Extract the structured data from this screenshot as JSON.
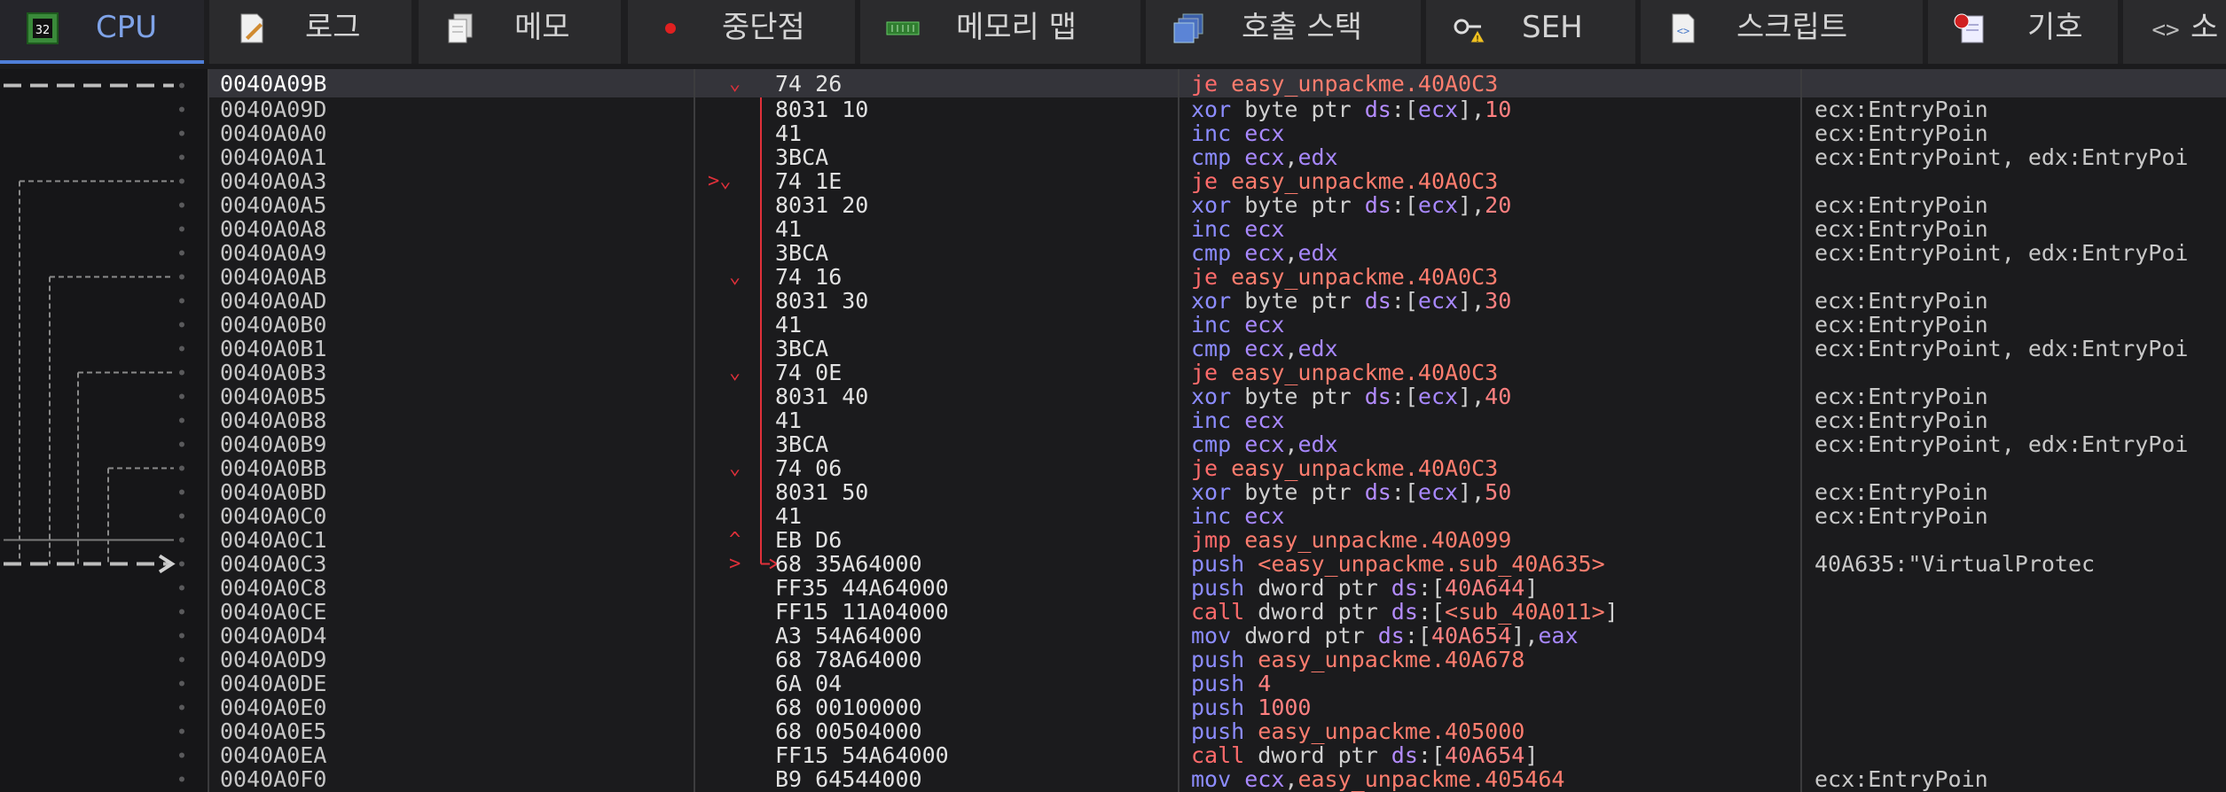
{
  "tabs": [
    {
      "label": "CPU",
      "icon": "cpu-chip-icon",
      "active": true
    },
    {
      "label": "로그",
      "icon": "log-icon"
    },
    {
      "label": "메모",
      "icon": "notes-icon"
    },
    {
      "label": "중단점",
      "icon": "breakpoint-icon"
    },
    {
      "label": "메모리 맵",
      "icon": "memory-map-icon"
    },
    {
      "label": "호출 스택",
      "icon": "call-stack-icon"
    },
    {
      "label": "SEH",
      "icon": "seh-icon"
    },
    {
      "label": "스크립트",
      "icon": "script-icon"
    },
    {
      "label": "기호",
      "icon": "symbols-icon"
    },
    {
      "label": "소",
      "icon": "source-icon"
    }
  ],
  "colors": {
    "accent": "#4f7fd8",
    "jump": "#ff6b6b",
    "register": "#a888ff",
    "arrow": "#e0303a"
  },
  "rows": [
    {
      "addr": "0040A09B",
      "bytes": "74 26",
      "mn": "je",
      "ops": "easy_unpackme.40A0C3",
      "comment": "",
      "sel": true,
      "mark": "⌄"
    },
    {
      "addr": "0040A09D",
      "bytes": "8031 10",
      "mn": "xor",
      "ops": "byte ptr ds:[ecx],10",
      "comment": "ecx:EntryPoin"
    },
    {
      "addr": "0040A0A0",
      "bytes": "41",
      "mn": "inc",
      "ops": "ecx",
      "comment": "ecx:EntryPoin"
    },
    {
      "addr": "0040A0A1",
      "bytes": "3BCA",
      "mn": "cmp",
      "ops": "ecx,edx",
      "comment": "ecx:EntryPoint, edx:EntryPoi"
    },
    {
      "addr": "0040A0A3",
      "bytes": "74 1E",
      "mn": "je",
      "ops": "easy_unpackme.40A0C3",
      "comment": "",
      "mark": ">⌄"
    },
    {
      "addr": "0040A0A5",
      "bytes": "8031 20",
      "mn": "xor",
      "ops": "byte ptr ds:[ecx],20",
      "comment": "ecx:EntryPoin"
    },
    {
      "addr": "0040A0A8",
      "bytes": "41",
      "mn": "inc",
      "ops": "ecx",
      "comment": "ecx:EntryPoin"
    },
    {
      "addr": "0040A0A9",
      "bytes": "3BCA",
      "mn": "cmp",
      "ops": "ecx,edx",
      "comment": "ecx:EntryPoint, edx:EntryPoi"
    },
    {
      "addr": "0040A0AB",
      "bytes": "74 16",
      "mn": "je",
      "ops": "easy_unpackme.40A0C3",
      "comment": "",
      "mark": "⌄"
    },
    {
      "addr": "0040A0AD",
      "bytes": "8031 30",
      "mn": "xor",
      "ops": "byte ptr ds:[ecx],30",
      "comment": "ecx:EntryPoin"
    },
    {
      "addr": "0040A0B0",
      "bytes": "41",
      "mn": "inc",
      "ops": "ecx",
      "comment": "ecx:EntryPoin"
    },
    {
      "addr": "0040A0B1",
      "bytes": "3BCA",
      "mn": "cmp",
      "ops": "ecx,edx",
      "comment": "ecx:EntryPoint, edx:EntryPoi"
    },
    {
      "addr": "0040A0B3",
      "bytes": "74 0E",
      "mn": "je",
      "ops": "easy_unpackme.40A0C3",
      "comment": "",
      "mark": "⌄"
    },
    {
      "addr": "0040A0B5",
      "bytes": "8031 40",
      "mn": "xor",
      "ops": "byte ptr ds:[ecx],40",
      "comment": "ecx:EntryPoin"
    },
    {
      "addr": "0040A0B8",
      "bytes": "41",
      "mn": "inc",
      "ops": "ecx",
      "comment": "ecx:EntryPoin"
    },
    {
      "addr": "0040A0B9",
      "bytes": "3BCA",
      "mn": "cmp",
      "ops": "ecx,edx",
      "comment": "ecx:EntryPoint, edx:EntryPoi"
    },
    {
      "addr": "0040A0BB",
      "bytes": "74 06",
      "mn": "je",
      "ops": "easy_unpackme.40A0C3",
      "comment": "",
      "mark": "⌄"
    },
    {
      "addr": "0040A0BD",
      "bytes": "8031 50",
      "mn": "xor",
      "ops": "byte ptr ds:[ecx],50",
      "comment": "ecx:EntryPoin"
    },
    {
      "addr": "0040A0C0",
      "bytes": "41",
      "mn": "inc",
      "ops": "ecx",
      "comment": "ecx:EntryPoin"
    },
    {
      "addr": "0040A0C1",
      "bytes": "EB D6",
      "mn": "jmp",
      "ops": "easy_unpackme.40A099",
      "comment": "",
      "mark": "^"
    },
    {
      "addr": "0040A0C3",
      "bytes": "68 35A64000",
      "mn": "push",
      "ops": "<easy_unpackme.sub_40A635>",
      "comment": "40A635:\"VirtualProtec",
      "mark": ">"
    },
    {
      "addr": "0040A0C8",
      "bytes": "FF35 44A64000",
      "mn": "push",
      "ops": "dword ptr ds:[40A644]",
      "comment": ""
    },
    {
      "addr": "0040A0CE",
      "bytes": "FF15 11A04000",
      "mn": "call",
      "ops": "dword ptr ds:[<sub_40A011>]",
      "comment": ""
    },
    {
      "addr": "0040A0D4",
      "bytes": "A3 54A64000",
      "mn": "mov",
      "ops": "dword ptr ds:[40A654],eax",
      "comment": ""
    },
    {
      "addr": "0040A0D9",
      "bytes": "68 78A64000",
      "mn": "push",
      "ops": "easy_unpackme.40A678",
      "comment": ""
    },
    {
      "addr": "0040A0DE",
      "bytes": "6A 04",
      "mn": "push",
      "ops": "4",
      "comment": ""
    },
    {
      "addr": "0040A0E0",
      "bytes": "68 00100000",
      "mn": "push",
      "ops": "1000",
      "comment": ""
    },
    {
      "addr": "0040A0E5",
      "bytes": "68 00504000",
      "mn": "push",
      "ops": "easy_unpackme.405000",
      "comment": ""
    },
    {
      "addr": "0040A0EA",
      "bytes": "FF15 54A64000",
      "mn": "call",
      "ops": "dword ptr ds:[40A654]",
      "comment": ""
    },
    {
      "addr": "0040A0F0",
      "bytes": "B9 64544000",
      "mn": "mov",
      "ops": "ecx,easy_unpackme.405464",
      "comment": "ecx:EntryPoin"
    }
  ]
}
